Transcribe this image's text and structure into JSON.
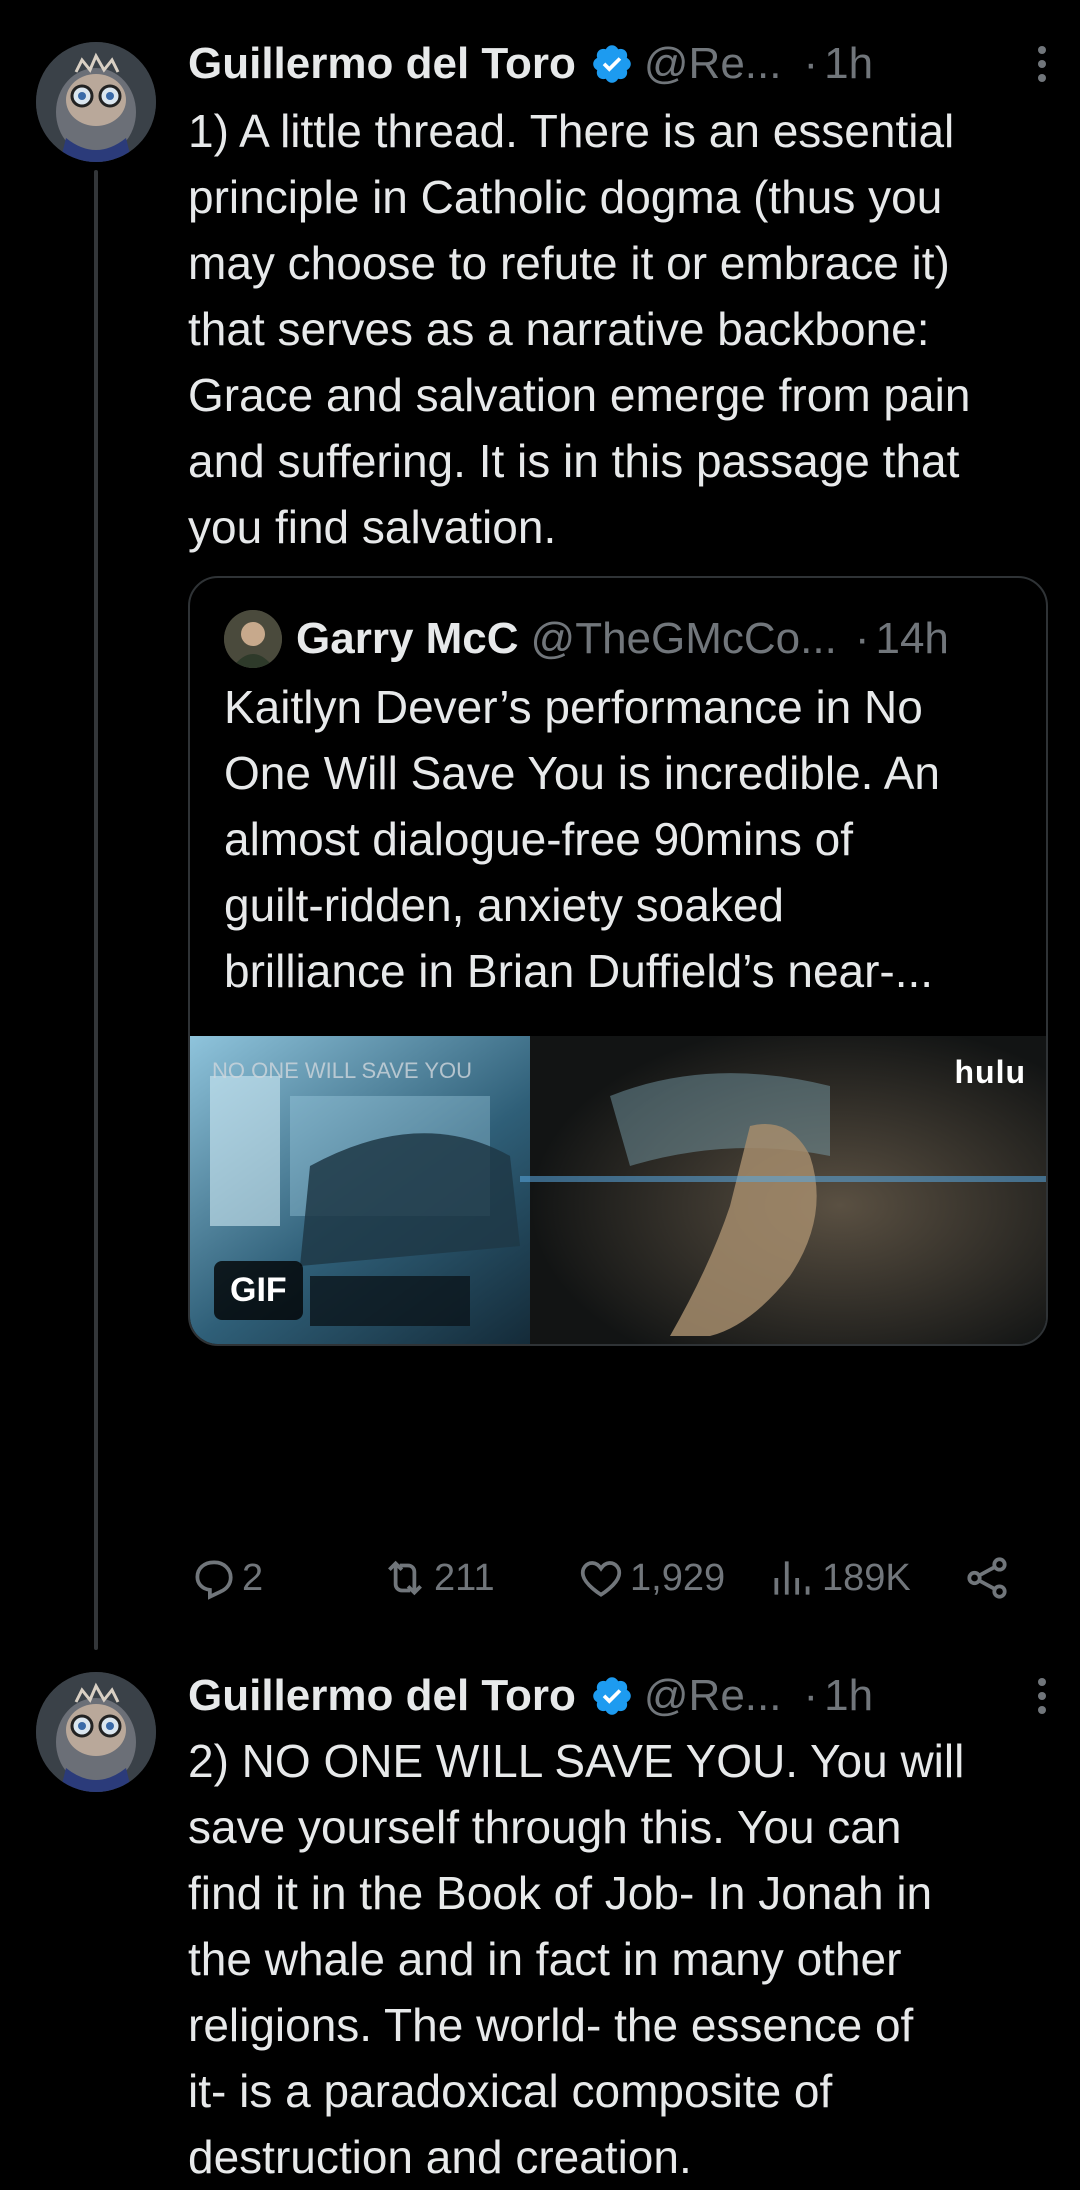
{
  "tweets": [
    {
      "author_name": "Guillermo del Toro",
      "handle": "@Re...",
      "dot": "·",
      "time": "1h",
      "lines": [
        "1) A little thread. There is an essential",
        "principle in Catholic dogma (thus you",
        "may choose to refute it or embrace it)",
        "that serves as a narrative backbone:",
        "Grace and salvation emerge from pain",
        "and suffering.  It is in this passage that",
        "you find salvation."
      ],
      "quote": {
        "author_name": "Garry McC",
        "handle": "@TheGMcCo...",
        "dot": "·",
        "time": "14h",
        "lines": [
          "Kaitlyn Dever’s performance in No",
          "One Will Save You is incredible. An",
          "almost dialogue-free 90mins of",
          "guilt-ridden, anxiety soaked",
          "brilliance in Brian Duffield’s near-..."
        ],
        "media": {
          "overlay_title": "NO ONE WILL SAVE YOU",
          "network": "hulu",
          "badge": "GIF"
        }
      },
      "actions": {
        "replies": "2",
        "reposts": "211",
        "likes": "1,929",
        "views": "189K"
      }
    },
    {
      "author_name": "Guillermo del Toro",
      "handle": "@Re...",
      "dot": "·",
      "time": "1h",
      "lines": [
        "2) NO ONE WILL SAVE YOU. You will",
        "save yourself through this.  You can",
        "find it in the Book of Job- In Jonah in",
        "the whale and in fact in many other",
        "religions. The world-  the essence of",
        "it- is a paradoxical composite of",
        "destruction and creation."
      ]
    }
  ],
  "colors": {
    "background": "#000000",
    "text": "#e7e9ea",
    "secondary": "#71767b",
    "verified": "#1d9bf0",
    "border": "#2f3336"
  },
  "icons": [
    "verified-badge-icon",
    "more-options-icon",
    "reply-icon",
    "repost-icon",
    "like-icon",
    "views-icon",
    "share-icon"
  ]
}
